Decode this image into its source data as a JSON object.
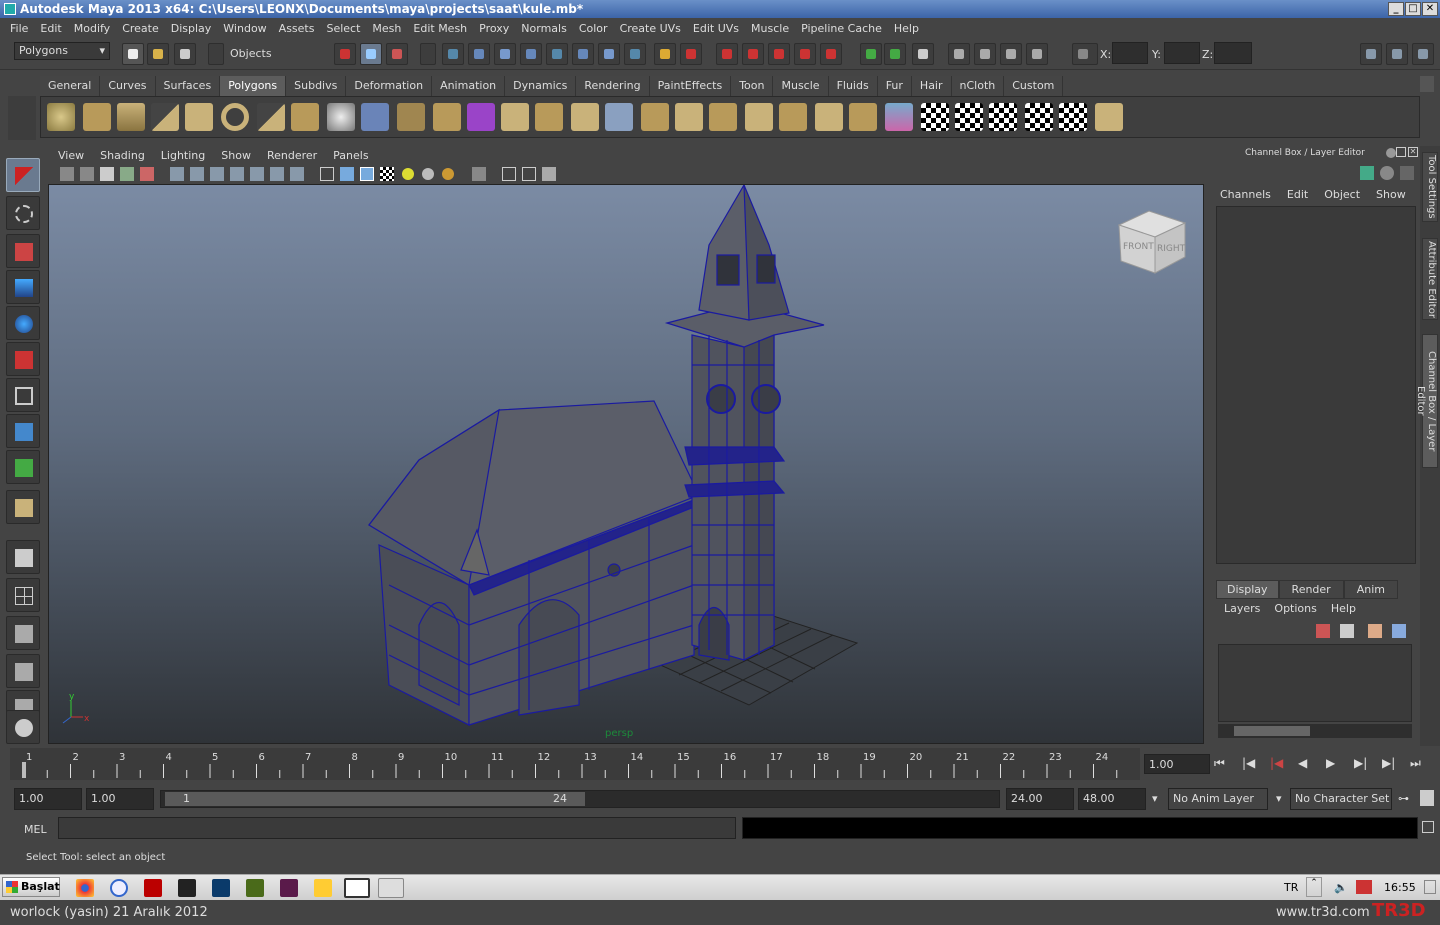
{
  "window": {
    "title": "Autodesk Maya 2013 x64: C:\\Users\\LEONX\\Documents\\maya\\projects\\saat\\kule.mb*",
    "controls": [
      "_",
      "□",
      "✕"
    ]
  },
  "menubar": [
    "File",
    "Edit",
    "Modify",
    "Create",
    "Display",
    "Window",
    "Assets",
    "Select",
    "Mesh",
    "Edit Mesh",
    "Proxy",
    "Normals",
    "Color",
    "Create UVs",
    "Edit UVs",
    "Muscle",
    "Pipeline Cache",
    "Help"
  ],
  "statusline": {
    "menuset": "Polygons",
    "selection_mode": "Objects",
    "x_label": "X:",
    "y_label": "Y:",
    "z_label": "Z:"
  },
  "shelf": {
    "tabs": [
      "General",
      "Curves",
      "Surfaces",
      "Polygons",
      "Subdivs",
      "Deformation",
      "Animation",
      "Dynamics",
      "Rendering",
      "PaintEffects",
      "Toon",
      "Muscle",
      "Fluids",
      "Fur",
      "Hair",
      "nCloth",
      "Custom"
    ],
    "active_tab": "Polygons"
  },
  "viewport": {
    "menu": [
      "View",
      "Shading",
      "Lighting",
      "Show",
      "Renderer",
      "Panels"
    ],
    "camera_label": "persp",
    "viewcube_front": "FRONT",
    "viewcube_right": "RIGHT",
    "axis_y": "y",
    "axis_x": "x"
  },
  "channel_box": {
    "header": "Channel Box / Layer Editor",
    "menu": [
      "Channels",
      "Edit",
      "Object",
      "Show"
    ]
  },
  "layer_editor": {
    "tabs": [
      "Display",
      "Render",
      "Anim"
    ],
    "active_tab": "Display",
    "menu": [
      "Layers",
      "Options",
      "Help"
    ]
  },
  "side_tabs": [
    "Tool Settings",
    "Attribute Editor",
    "Channel Box / Layer Editor"
  ],
  "timeline": {
    "ticks": [
      "1",
      "2",
      "3",
      "4",
      "5",
      "6",
      "7",
      "8",
      "9",
      "10",
      "11",
      "12",
      "13",
      "14",
      "15",
      "16",
      "17",
      "18",
      "19",
      "20",
      "21",
      "22",
      "23",
      "24"
    ],
    "current_frame": "1.00"
  },
  "range": {
    "start": "1.00",
    "playback_start": "1.00",
    "slider_start": "1",
    "slider_end": "24",
    "playback_end": "24.00",
    "end": "48.00",
    "anim_layer": "No Anim Layer",
    "character_set": "No Character Set"
  },
  "command": {
    "label": "MEL"
  },
  "helpline": "Select Tool: select an object",
  "taskbar": {
    "start": "Başlat",
    "language": "TR",
    "clock": "16:55"
  },
  "footer": {
    "author": "worlock (yasin)  21 Aralık 2012",
    "site": "www.tr3d.com",
    "logo": "TR3D"
  },
  "colors": {
    "ui_bg": "#444444",
    "selected_tool": "#6a7a8f",
    "wireframe": "#1a1aa0",
    "title_blue": "#3c64a8"
  }
}
